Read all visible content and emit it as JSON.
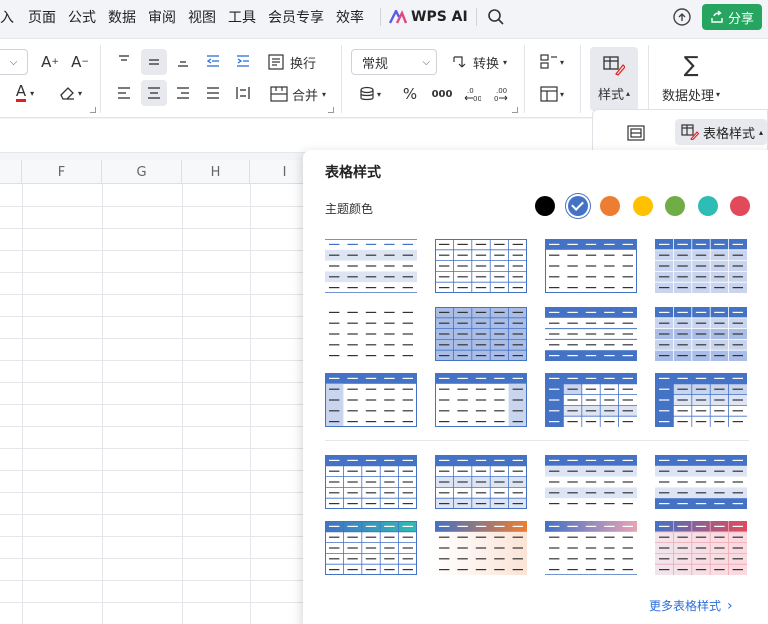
{
  "menu": {
    "items": [
      "入",
      "页面",
      "公式",
      "数据",
      "审阅",
      "视图",
      "工具",
      "会员专享",
      "效率"
    ],
    "wps_ai": "WPS AI",
    "share": "分享"
  },
  "ribbon": {
    "wrap_label": "换行",
    "number_format_value": "常规",
    "convert_label": "转换",
    "merge_label": "合并",
    "style_label": "样式",
    "data_process_label": "数据处理",
    "percent": "%",
    "thousands": "000"
  },
  "sub_toolbar": {
    "table_style_label": "表格样式"
  },
  "sheet": {
    "columns": [
      "F",
      "G",
      "H",
      "I"
    ]
  },
  "panel": {
    "title": "表格样式",
    "theme_color_label": "主题颜色",
    "theme_colors": [
      "#000000",
      "#4472c4",
      "#ed7d31",
      "#ffc000",
      "#70ad47",
      "#2ebcb4",
      "#e24a5b"
    ],
    "selected_color_index": 1,
    "more_link": "更多表格样式"
  }
}
